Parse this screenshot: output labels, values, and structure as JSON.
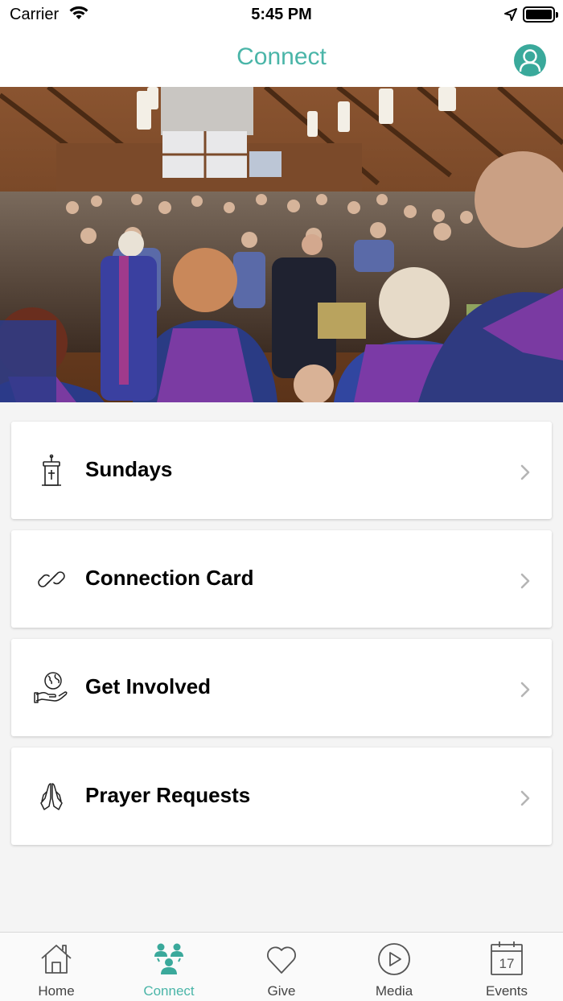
{
  "status_bar": {
    "carrier": "Carrier",
    "time": "5:45 PM"
  },
  "nav": {
    "title": "Connect",
    "accent_color": "#4ab5a8"
  },
  "hero": {
    "description_icon": "church-congregation-photo"
  },
  "menu": {
    "items": [
      {
        "label": "Sundays",
        "icon": "pulpit-icon"
      },
      {
        "label": "Connection Card",
        "icon": "link-icon"
      },
      {
        "label": "Get Involved",
        "icon": "globe-hand-icon"
      },
      {
        "label": "Prayer Requests",
        "icon": "praying-hands-icon"
      }
    ]
  },
  "tabs": [
    {
      "label": "Home",
      "icon": "home-icon",
      "active": false
    },
    {
      "label": "Connect",
      "icon": "people-icon",
      "active": true
    },
    {
      "label": "Give",
      "icon": "heart-icon",
      "active": false
    },
    {
      "label": "Media",
      "icon": "play-icon",
      "active": false
    },
    {
      "label": "Events",
      "icon": "calendar-icon",
      "active": false,
      "calendar_day": "17"
    }
  ]
}
